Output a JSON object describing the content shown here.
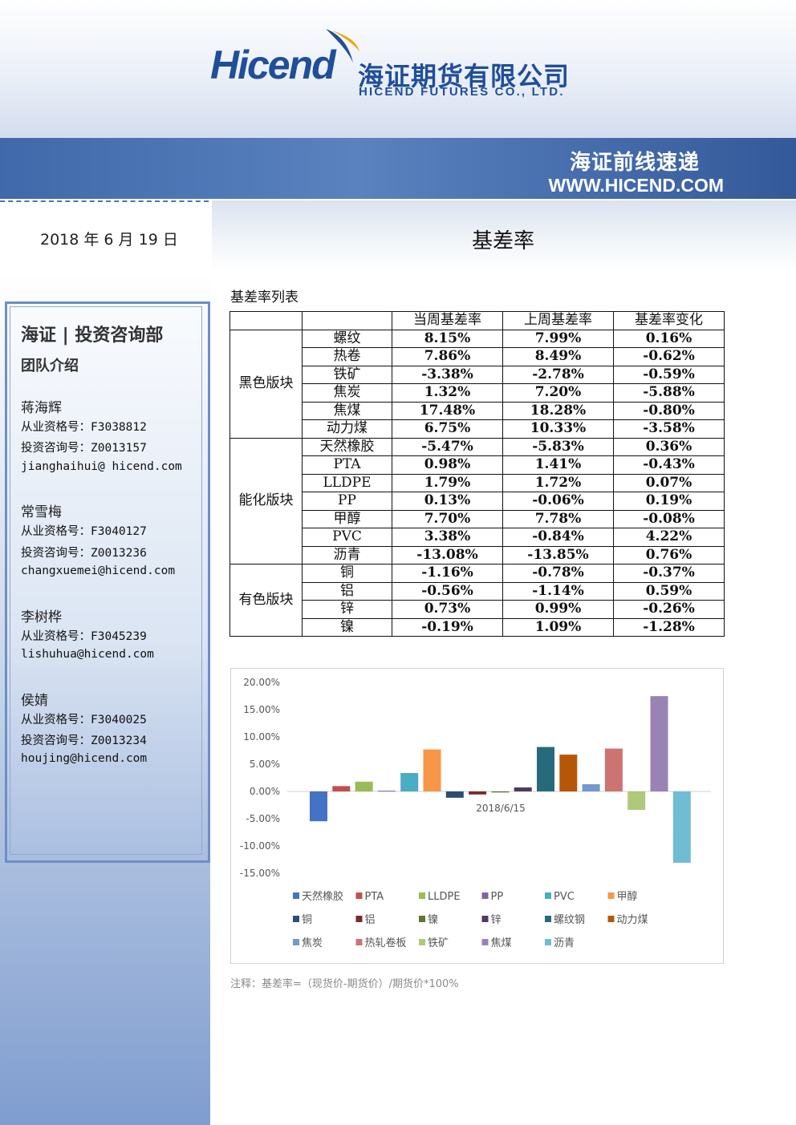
{
  "header": {
    "logo_en": "Hicend",
    "logo_cn": "海证期货有限公司",
    "logo_sub": "HICEND FUTURES CO., LTD.",
    "banner_title": "海证前线速递",
    "banner_url": "WWW.HICEND.COM",
    "brand_color": "#1f4e9a"
  },
  "date": "2018 年 6 月 19 日",
  "page_title": "基差率",
  "sidebar": {
    "dept": "海证 | 投资咨询部",
    "team": "团队介绍",
    "members": [
      {
        "name": "蒋海辉",
        "cert": "从业资格号：F3038812",
        "advisory": "投资咨询号：Z0013157",
        "email": "jianghaihui@ hicend.com"
      },
      {
        "name": "常雪梅",
        "cert": "从业资格号：F3040127",
        "advisory": "投资咨询号：Z0013236",
        "email": "changxuemei@hicend.com"
      },
      {
        "name": "李树桦",
        "cert": "从业资格号：F3045239",
        "advisory": "",
        "email": "lishuhua@hicend.com"
      },
      {
        "name": "侯婧",
        "cert": "从业资格号：F3040025",
        "advisory": "投资咨询号：Z0013234",
        "email": "houjing@hicend.com"
      }
    ]
  },
  "table": {
    "heading": "基差率列表",
    "columns": [
      "当周基差率",
      "上周基差率",
      "基差率变化"
    ],
    "sectors": [
      {
        "name": "黑色版块",
        "rows": [
          {
            "product": "螺纹",
            "cur": "8.15%",
            "prev": "7.99%",
            "chg": "0.16%"
          },
          {
            "product": "热卷",
            "cur": "7.86%",
            "prev": "8.49%",
            "chg": "-0.62%"
          },
          {
            "product": "铁矿",
            "cur": "-3.38%",
            "prev": "-2.78%",
            "chg": "-0.59%"
          },
          {
            "product": "焦炭",
            "cur": "1.32%",
            "prev": "7.20%",
            "chg": "-5.88%"
          },
          {
            "product": "焦煤",
            "cur": "17.48%",
            "prev": "18.28%",
            "chg": "-0.80%"
          },
          {
            "product": "动力煤",
            "cur": "6.75%",
            "prev": "10.33%",
            "chg": "-3.58%"
          }
        ]
      },
      {
        "name": "能化版块",
        "rows": [
          {
            "product": "天然橡胶",
            "cur": "-5.47%",
            "prev": "-5.83%",
            "chg": "0.36%"
          },
          {
            "product": "PTA",
            "cur": "0.98%",
            "prev": "1.41%",
            "chg": "-0.43%"
          },
          {
            "product": "LLDPE",
            "cur": "1.79%",
            "prev": "1.72%",
            "chg": "0.07%"
          },
          {
            "product": "PP",
            "cur": "0.13%",
            "prev": "-0.06%",
            "chg": "0.19%"
          },
          {
            "product": "甲醇",
            "cur": "7.70%",
            "prev": "7.78%",
            "chg": "-0.08%"
          },
          {
            "product": "PVC",
            "cur": "3.38%",
            "prev": "-0.84%",
            "chg": "4.22%"
          },
          {
            "product": "沥青",
            "cur": "-13.08%",
            "prev": "-13.85%",
            "chg": "0.76%"
          }
        ]
      },
      {
        "name": "有色版块",
        "rows": [
          {
            "product": "铜",
            "cur": "-1.16%",
            "prev": "-0.78%",
            "chg": "-0.37%"
          },
          {
            "product": "铝",
            "cur": "-0.56%",
            "prev": "-1.14%",
            "chg": "0.59%"
          },
          {
            "product": "锌",
            "cur": "0.73%",
            "prev": "0.99%",
            "chg": "-0.26%"
          },
          {
            "product": "镍",
            "cur": "-0.19%",
            "prev": "1.09%",
            "chg": "-1.28%"
          }
        ]
      }
    ]
  },
  "chart_data": {
    "type": "bar",
    "title": "",
    "xlabel": "",
    "ylabel": "",
    "categories": [
      "2018/6/15"
    ],
    "ylim": [
      -15,
      20
    ],
    "yticks": [
      "20.00%",
      "15.00%",
      "10.00%",
      "5.00%",
      "0.00%",
      "-5.00%",
      "-10.00%",
      "-15.00%"
    ],
    "grid": false,
    "legend_position": "bottom",
    "series": [
      {
        "name": "天然橡胶",
        "value": -5.47,
        "color": "#4472c4"
      },
      {
        "name": "PTA",
        "value": 0.98,
        "color": "#c0504d"
      },
      {
        "name": "LLDPE",
        "value": 1.79,
        "color": "#9bbb59"
      },
      {
        "name": "PP",
        "value": 0.13,
        "color": "#8064a2"
      },
      {
        "name": "PVC",
        "value": 3.38,
        "color": "#4bacc6"
      },
      {
        "name": "甲醇",
        "value": 7.7,
        "color": "#f79646"
      },
      {
        "name": "铜",
        "value": -1.16,
        "color": "#2c4d75"
      },
      {
        "name": "铝",
        "value": -0.56,
        "color": "#772c2a"
      },
      {
        "name": "镍",
        "value": -0.19,
        "color": "#5f7530"
      },
      {
        "name": "锌",
        "value": 0.73,
        "color": "#4d3b62"
      },
      {
        "name": "螺纹钢",
        "value": 8.15,
        "color": "#276a7c"
      },
      {
        "name": "动力煤",
        "value": 6.75,
        "color": "#b65708"
      },
      {
        "name": "焦炭",
        "value": 1.32,
        "color": "#729aca"
      },
      {
        "name": "热轧卷板",
        "value": 7.86,
        "color": "#cd7371"
      },
      {
        "name": "铁矿",
        "value": -3.38,
        "color": "#afc97a"
      },
      {
        "name": "焦煤",
        "value": 17.48,
        "color": "#9983b5"
      },
      {
        "name": "沥青",
        "value": -13.08,
        "color": "#6fbdd1"
      }
    ]
  },
  "note": "注释：基差率=（现货价-期货价）/期货价*100%"
}
